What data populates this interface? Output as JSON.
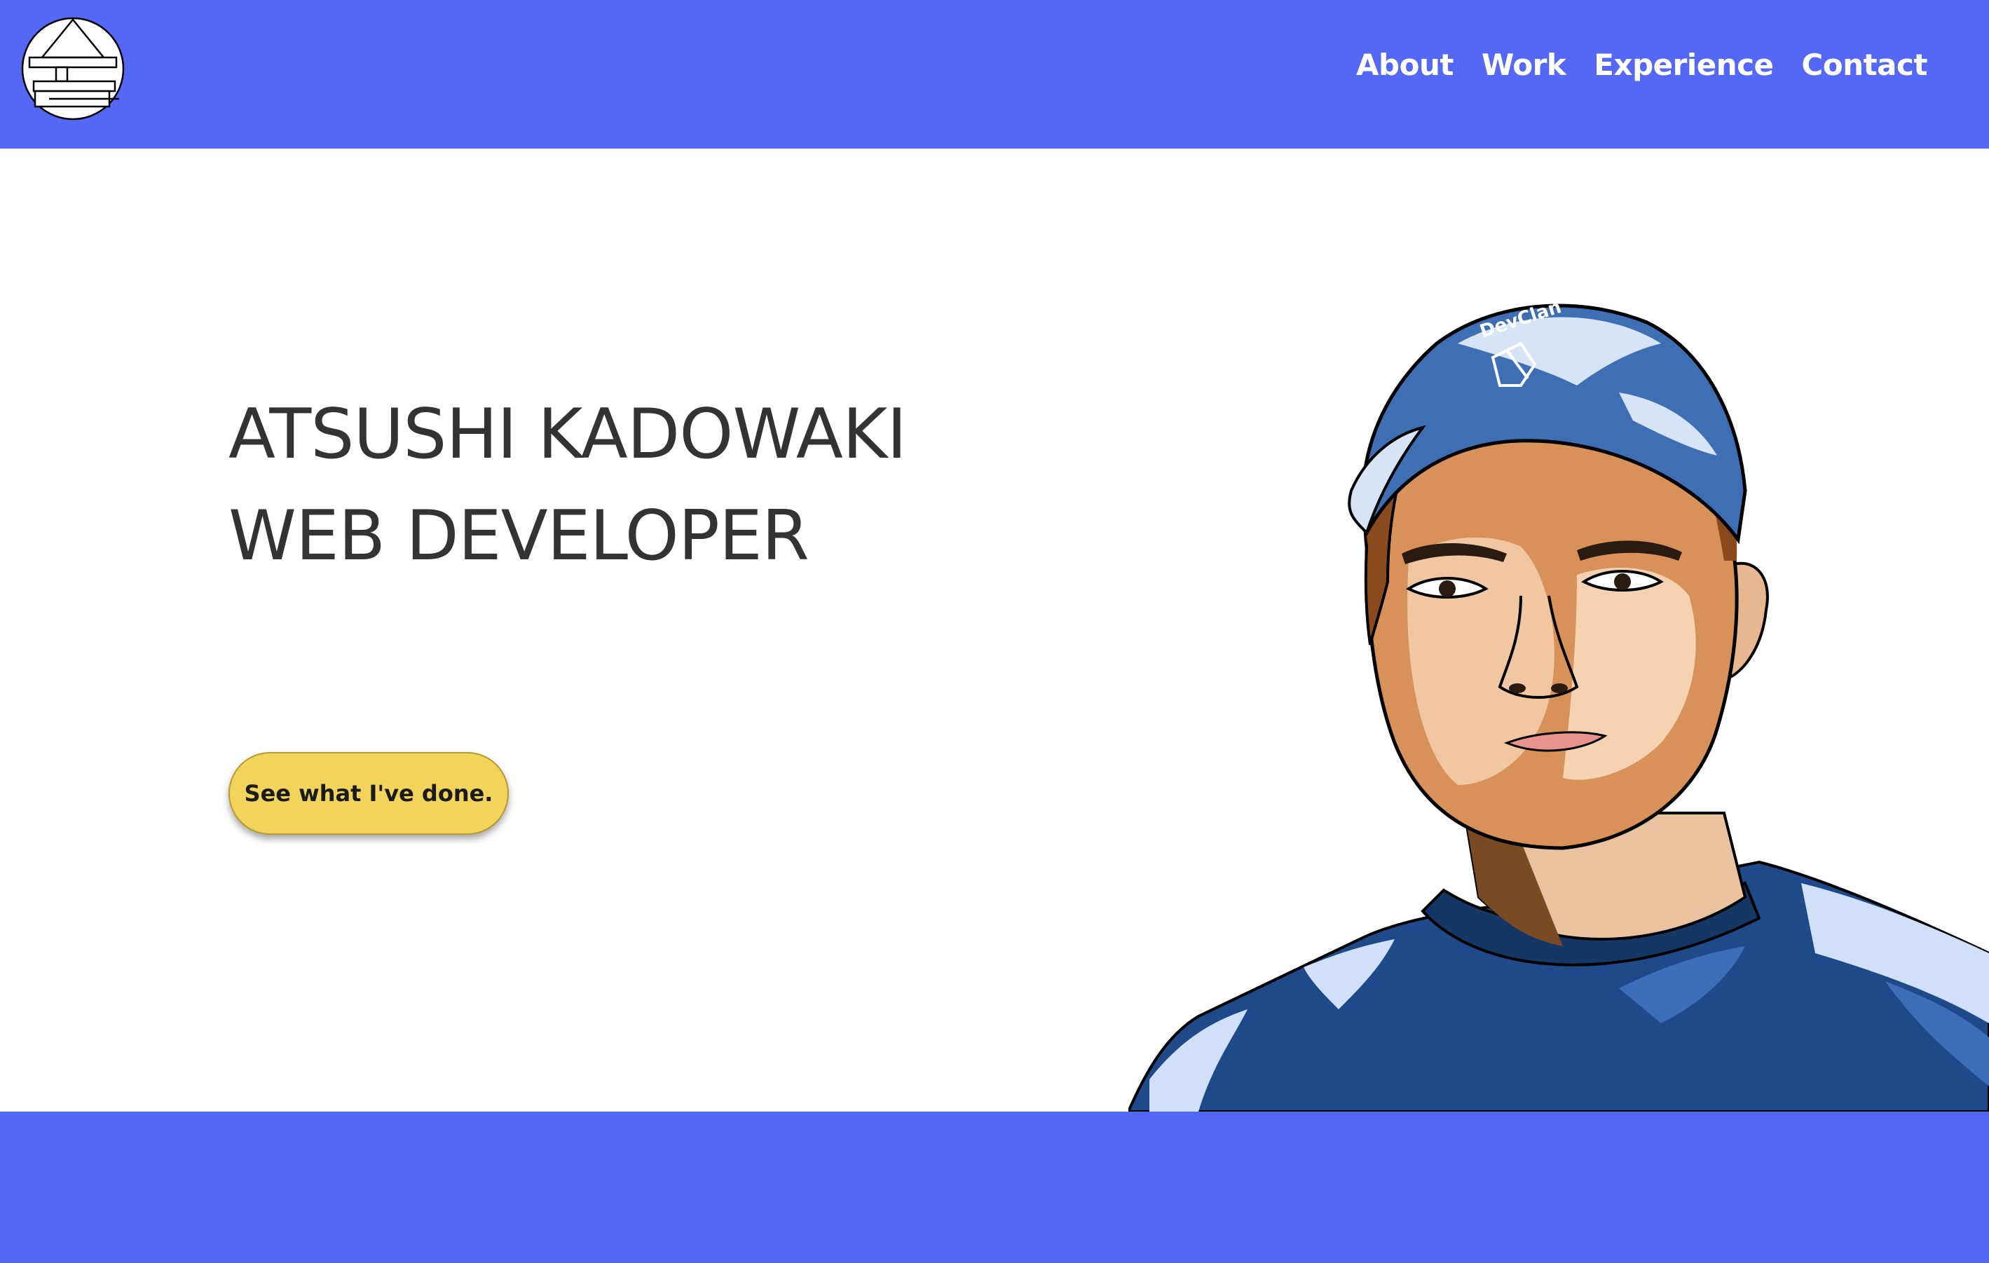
{
  "header": {
    "logo_name": "site-logo",
    "nav": [
      {
        "label": "About"
      },
      {
        "label": "Work"
      },
      {
        "label": "Experience"
      },
      {
        "label": "Contact"
      }
    ]
  },
  "hero": {
    "name": "ATSUSHI KADOWAKI",
    "role": "WEB DEVELOPER",
    "cta_label": "See what I've done.",
    "cap_text": "DevClan"
  },
  "colors": {
    "brand_blue": "#5468f5",
    "cta_yellow": "#f2d35b",
    "text_dark": "#333333"
  }
}
